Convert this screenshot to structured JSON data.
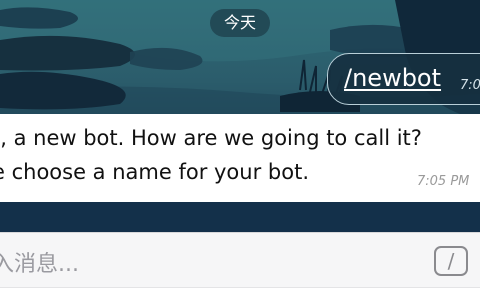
{
  "chat": {
    "date_separator": "今天",
    "outgoing": {
      "text": "/newbot",
      "time": "7:0"
    },
    "incoming": {
      "line1": "t, a new bot. How are we going to call it?",
      "line2": "e choose a name for your bot.",
      "time": "7:05 PM"
    }
  },
  "composer": {
    "placeholder": "入消息...",
    "command_icon": "slash-command-icon",
    "command_glyph": "/"
  },
  "colors": {
    "wallpaper_top": "#2f6b77",
    "wallpaper_bottom": "#13304a",
    "bubble_in": "#ffffff",
    "composer_bg": "#f6f6f7"
  }
}
